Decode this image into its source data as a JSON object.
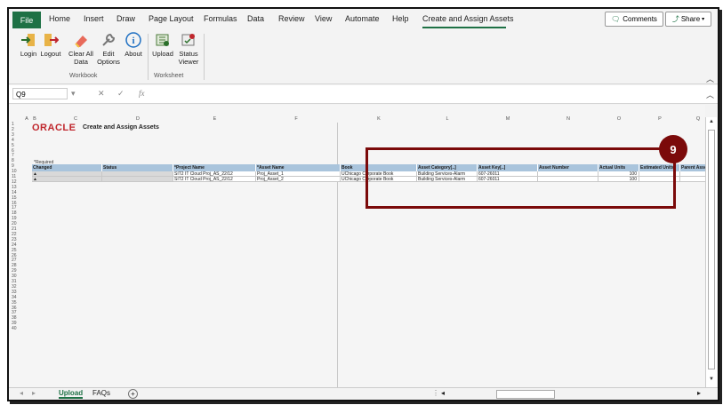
{
  "ribbon_tabs": {
    "file": "File",
    "home": "Home",
    "insert": "Insert",
    "draw": "Draw",
    "page_layout": "Page Layout",
    "formulas": "Formulas",
    "data": "Data",
    "review": "Review",
    "view": "View",
    "automate": "Automate",
    "help": "Help",
    "create_assign": "Create and Assign Assets"
  },
  "top_buttons": {
    "comments": "Comments",
    "share": "Share"
  },
  "ribbon": {
    "login": "Login",
    "logout": "Logout",
    "clear": "Clear All Data",
    "edit_options": "Edit Options",
    "about": "About",
    "upload": "Upload",
    "status_viewer": "Status Viewer",
    "workbook_group": "Workbook",
    "worksheet_group": "Worksheet"
  },
  "formula_bar": {
    "name_box": "Q9",
    "fx": "fx",
    "content": ""
  },
  "sheet": {
    "logo": "ORACLE",
    "title": "Create and Assign Assets",
    "required_note": "*Required",
    "headers": [
      "Changed",
      "Status",
      "*Project Name",
      "*Asset Name",
      "Book",
      "Asset Category[..]",
      "Asset Key[..]",
      "Asset Number",
      "Actual Units",
      "Estimated Units",
      "Parent Asset"
    ],
    "rows": [
      [
        "▲",
        "",
        "SIT2 IT Cloud Proj_AS_22/12",
        "Proj_Asset_1",
        "UChicago Corporate Book",
        "Building Services-Alarm",
        "607-26011",
        "",
        "100",
        "",
        ""
      ],
      [
        "▲",
        "",
        "SIT2 IT Cloud Proj_AS_22/12",
        "Proj_Asset_2",
        "UChicago Corporate Book",
        "Building Services-Alarm",
        "607-26011",
        "",
        "100",
        "",
        ""
      ]
    ],
    "columns": [
      "A",
      "B",
      "C",
      "D",
      "E",
      "F",
      "K",
      "L",
      "M",
      "N",
      "O",
      "P",
      "Q"
    ]
  },
  "callout": {
    "number": "9"
  },
  "sheet_tabs": {
    "upload": "Upload",
    "faqs": "FAQs",
    "add": "+"
  },
  "colors": {
    "accent": "#1e7145",
    "callout": "#7b0a0a",
    "header_fill": "#a9c4dc",
    "oracle_red": "#c0272d"
  }
}
